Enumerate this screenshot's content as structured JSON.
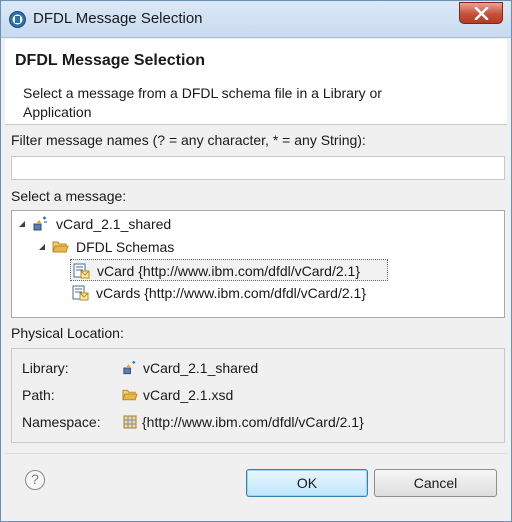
{
  "window": {
    "title": "DFDL Message Selection",
    "close_icon": "close-x-icon"
  },
  "banner": {
    "title": "DFDL Message Selection",
    "description": "Select a message from a DFDL schema file in a Library or Application"
  },
  "filter": {
    "label": "Filter message names (? = any character, * = any String):",
    "value": ""
  },
  "select": {
    "label": "Select a message:",
    "tree": [
      {
        "label": "vCard_2.1_shared",
        "icon": "library-icon",
        "level": 0,
        "expanded": true
      },
      {
        "label": "DFDL Schemas",
        "icon": "folder-open-icon",
        "level": 1,
        "expanded": true
      },
      {
        "label": "vCard {http://www.ibm.com/dfdl/vCard/2.1}",
        "icon": "message-icon",
        "level": 2,
        "selected": true
      },
      {
        "label": "vCards {http://www.ibm.com/dfdl/vCard/2.1}",
        "icon": "message-icon",
        "level": 2,
        "selected": false
      }
    ]
  },
  "physical": {
    "label": "Physical Location:",
    "library_key": "Library:",
    "library_value": "vCard_2.1_shared",
    "path_key": "Path:",
    "path_value": "vCard_2.1.xsd",
    "namespace_key": "Namespace:",
    "namespace_value": "{http://www.ibm.com/dfdl/vCard/2.1}"
  },
  "footer": {
    "help_label": "?",
    "ok_label": "OK",
    "cancel_label": "Cancel"
  },
  "colors": {
    "titlebar": "#c9dbef",
    "close_button": "#c7503a",
    "ok_border": "#3c7fb1",
    "folder": "#e8b64a"
  }
}
